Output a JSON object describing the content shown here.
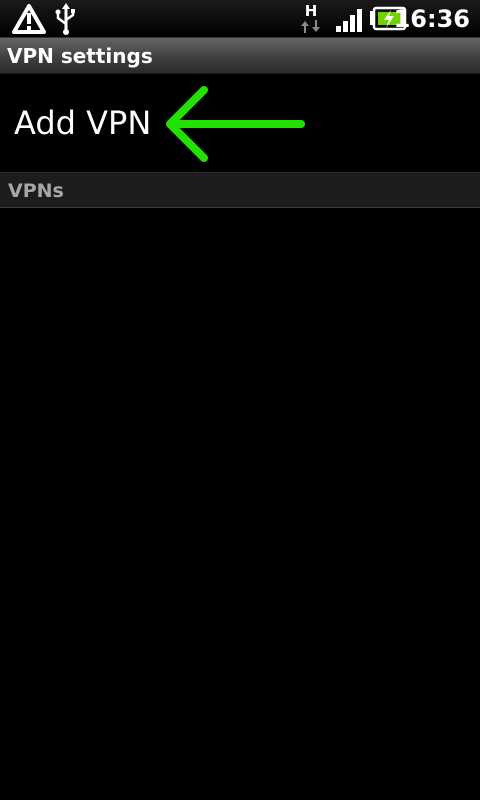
{
  "status_bar": {
    "time": "16:36",
    "icons": [
      "warning-icon",
      "usb-icon",
      "hspa-data-icon",
      "signal-strength-icon",
      "battery-charging-icon"
    ],
    "network_type": "H",
    "colors": {
      "battery_fill": "#6fd300",
      "icon": "#ffffff"
    }
  },
  "header": {
    "title": "VPN settings"
  },
  "main": {
    "add_vpn_label": "Add VPN",
    "annotation": {
      "icon": "arrow-left-icon",
      "color": "#22e000"
    },
    "section_title": "VPNs",
    "vpns": []
  }
}
